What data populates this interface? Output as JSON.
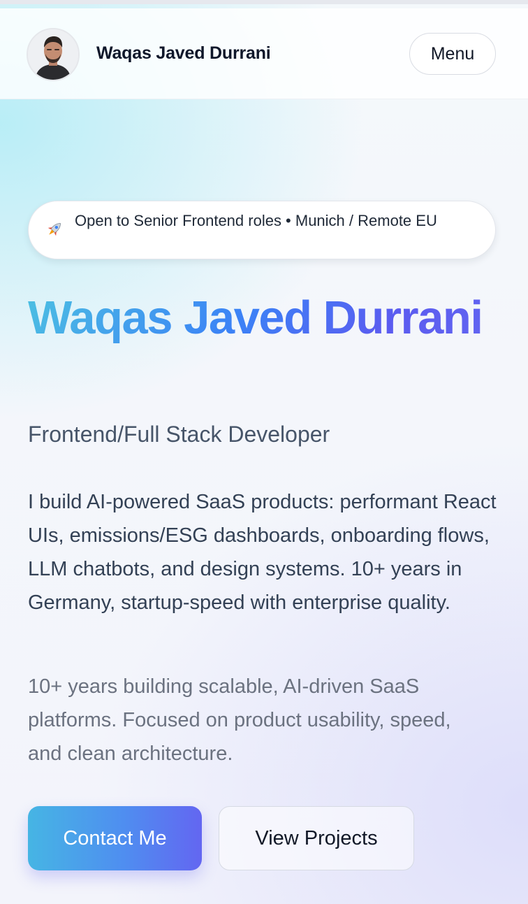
{
  "header": {
    "name": "Waqas Javed Durrani",
    "menu_label": "Menu"
  },
  "hero": {
    "badge": {
      "icon": "rocket-icon",
      "text": "Open to Senior Frontend roles • Munich / Remote EU"
    },
    "title": "Waqas Javed Durrani",
    "role": "Frontend/Full Stack Developer",
    "description": "I build AI-powered SaaS products: performant React UIs, emissions/ESG dashboards, onboarding flows, LLM chatbots, and design systems. 10+ years in Germany, startup-speed with enterprise quality.",
    "subtext": "10+ years building scalable, AI-driven SaaS platforms. Focused on product usability, speed, and clean architecture.",
    "primary_cta": "Contact Me",
    "secondary_cta": "View Projects"
  },
  "colors": {
    "gradient_start": "#4cc0e2",
    "gradient_mid": "#3b82f6",
    "gradient_end": "#6366f1",
    "text_dark": "#0f172a",
    "text_muted": "#6b7280"
  }
}
